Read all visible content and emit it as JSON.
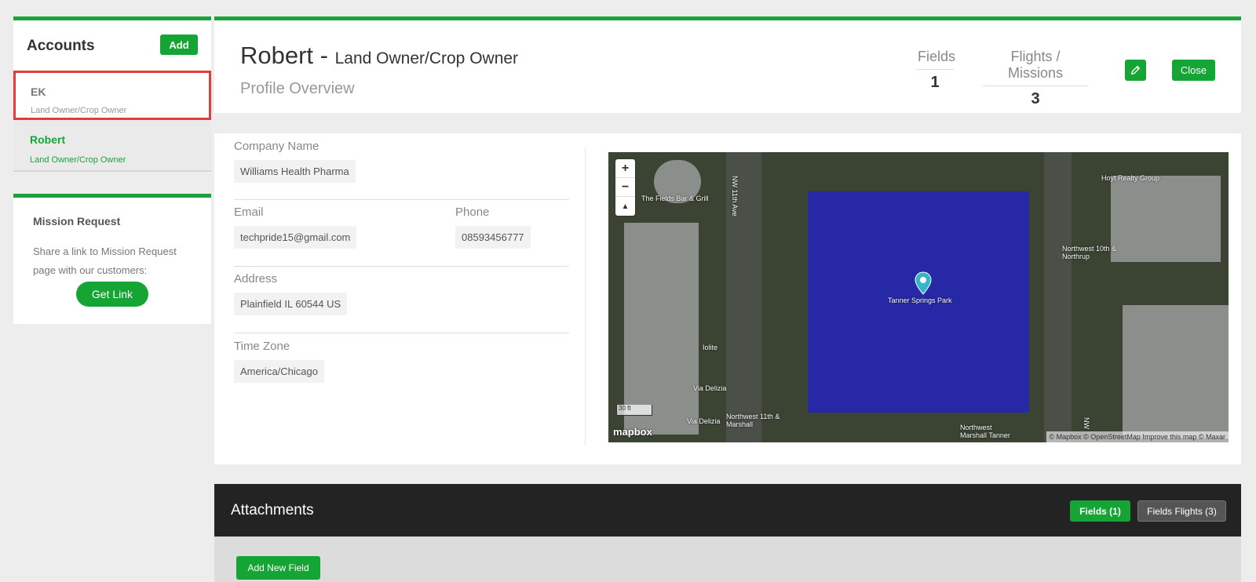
{
  "accounts": {
    "title": "Accounts",
    "add_label": "Add",
    "items": [
      {
        "name": "EK",
        "role": "Land Owner/Crop Owner"
      },
      {
        "name": "Robert",
        "role": "Land Owner/Crop Owner"
      }
    ]
  },
  "mission": {
    "title": "Mission Request",
    "desc": "Share a link to Mission Request page with our customers:",
    "button": "Get Link"
  },
  "header": {
    "name": "Robert -",
    "role": "Land Owner/Crop Owner",
    "subtitle": "Profile Overview",
    "stats": [
      {
        "label": "Fields",
        "value": "1"
      },
      {
        "label": "Flights / Missions",
        "value": "3"
      }
    ],
    "edit_icon": "pencil-icon",
    "close_label": "Close"
  },
  "profile": {
    "company_label": "Company Name",
    "company": "Williams Health Pharma",
    "email_label": "Email",
    "email": "techpride15@gmail.com",
    "phone_label": "Phone",
    "phone": "08593456777",
    "address_label": "Address",
    "address": "Plainfield IL 60544 US",
    "tz_label": "Time Zone",
    "tz": "America/Chicago"
  },
  "map": {
    "zoom_in": "+",
    "zoom_out": "−",
    "reset": "▲",
    "labels": {
      "bar": "The Fields Bar & Grill",
      "ave": "NW 11th Ave",
      "realty": "Hoyt Realty Group",
      "stop1": "Northwest 10th & Northrup",
      "park": "Tanner Springs Park",
      "iolite": "Iolite",
      "delizia1": "Via Delizia",
      "delizia2": "Via Delizia",
      "stop2": "Northwest 11th & Marshall",
      "stop3": "Northwest Marshall Tanner",
      "nw": "NW"
    },
    "scale": "30 ft",
    "logo": "mapbox",
    "attribution": "© Mapbox © OpenStreetMap Improve this map © Maxar"
  },
  "attachments": {
    "title": "Attachments",
    "tab_fields": "Fields (1)",
    "tab_flights": "Fields Flights (3)",
    "add_field": "Add New Field"
  },
  "colors": {
    "accent": "#1aa33b",
    "selected_border": "#e23c3c",
    "dark_bar": "#232323"
  }
}
